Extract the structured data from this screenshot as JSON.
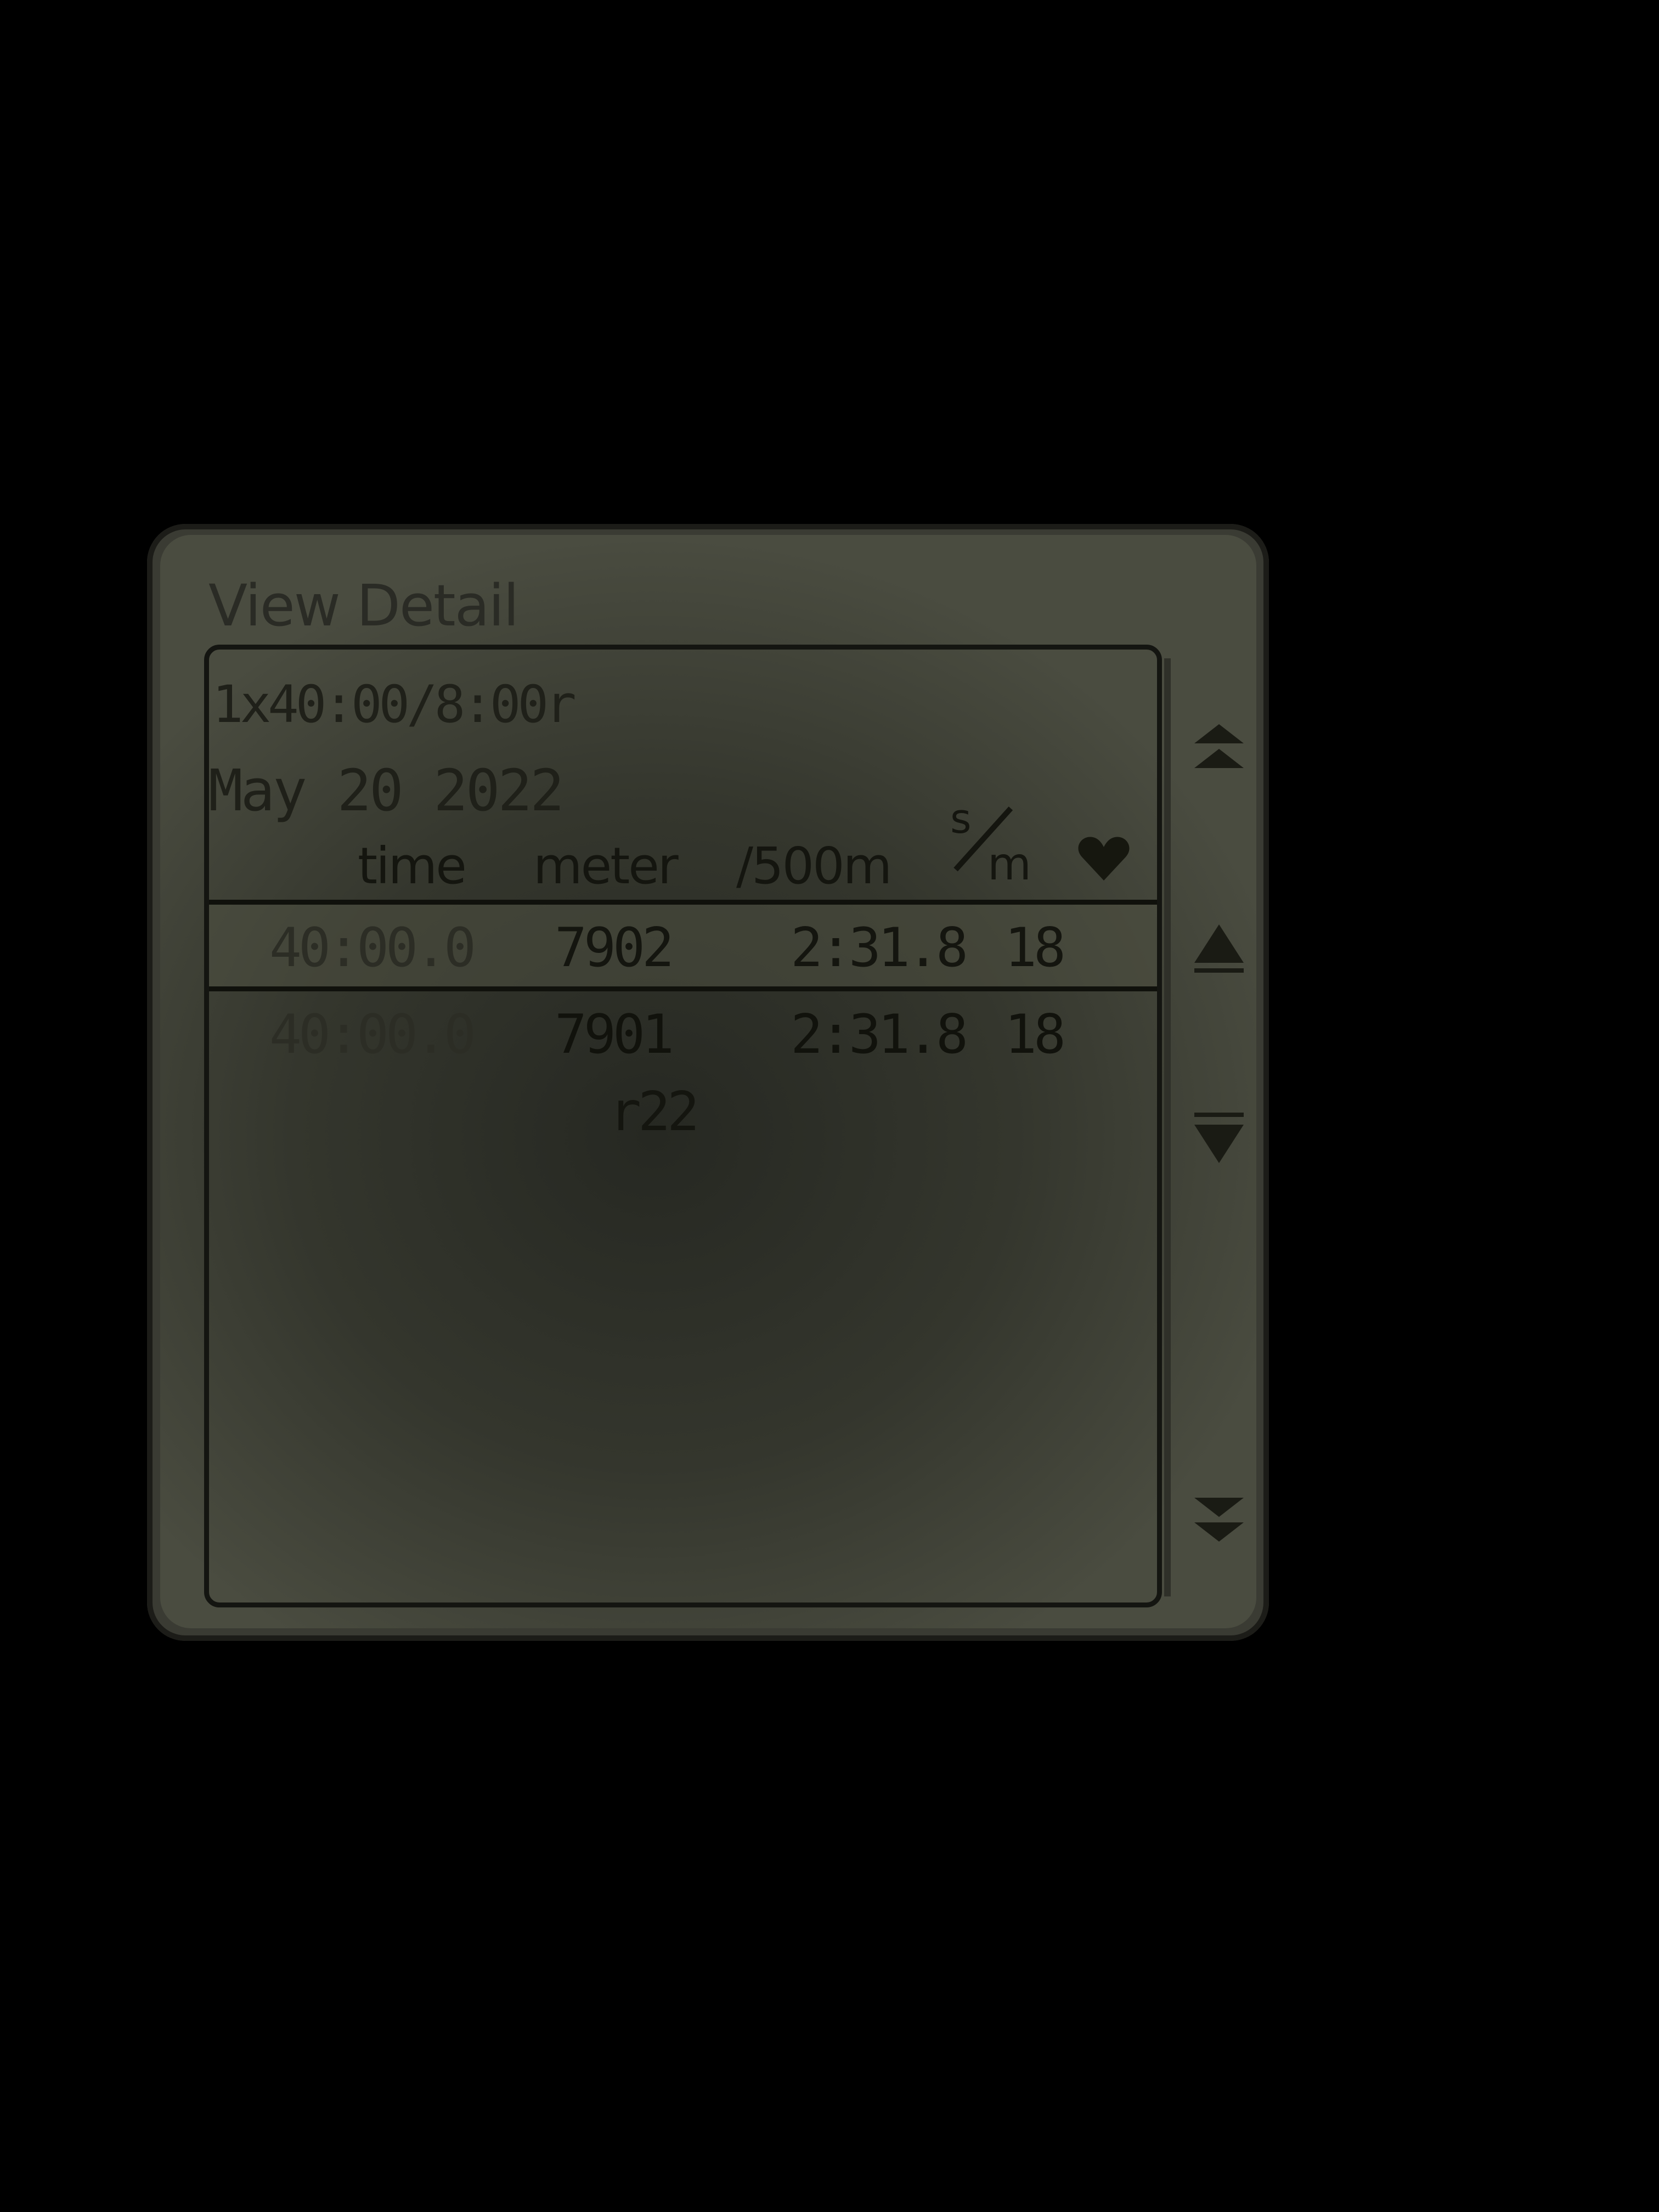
{
  "screen": {
    "title": "View Detail"
  },
  "workout": {
    "description": "1x40:00/8:00r",
    "date": "May  20 2022"
  },
  "table": {
    "columns": {
      "time": "time",
      "meter": "meter",
      "split": "/500m",
      "rate_numerator": "s",
      "rate_denominator": "m"
    },
    "rows": [
      {
        "time": "40:00.0",
        "meter": "7902",
        "split": "2:31.8",
        "rate": "18"
      },
      {
        "time": "40:00.0",
        "meter": "7901",
        "split": "2:31.8",
        "rate": "18"
      }
    ],
    "rest_label": "r22"
  },
  "icons": {
    "heart": "heart-icon",
    "page_up": "double-up-arrow-icon",
    "line_up": "up-arrow-icon",
    "line_down": "down-arrow-icon",
    "page_down": "double-down-arrow-icon"
  },
  "colors": {
    "lcd_background": "#34362d",
    "lcd_text": "#14150f",
    "page_background": "#000000"
  }
}
